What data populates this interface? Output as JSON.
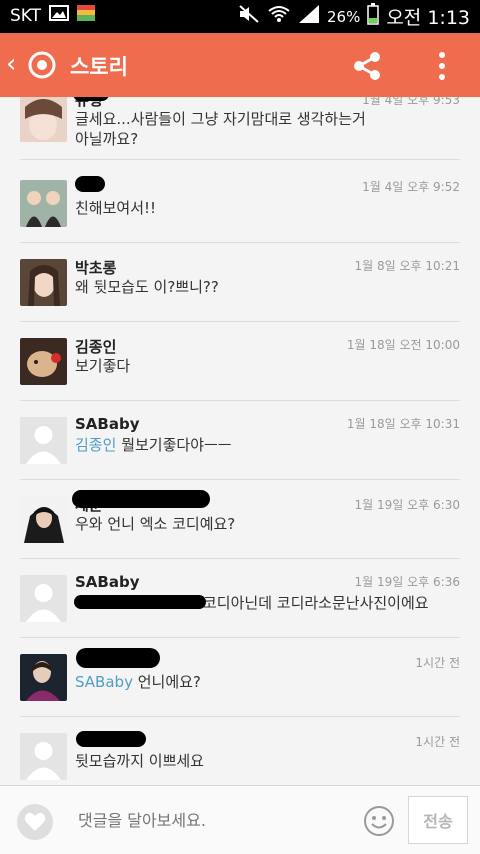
{
  "statusbar": {
    "carrier": "SKT",
    "battery_pct": "26%",
    "time": "오전 1:13"
  },
  "appbar": {
    "title": "스토리"
  },
  "comments": [
    {
      "name": "유형",
      "time": "1월 4일 오후 9:53",
      "lines": [
        "글세요...사람들이 그냥 자기맘대로 생각하는거",
        "아닐까요?"
      ]
    },
    {
      "name": "",
      "time": "1월 4일 오후 9:52",
      "lines": [
        "친해보여서!!"
      ]
    },
    {
      "name": "박초롱",
      "time": "1월 8일 오후 10:21",
      "lines": [
        "왜 뒷모습도 이?쁘니??"
      ]
    },
    {
      "name": "김종인",
      "time": "1월 18일 오전 10:00",
      "lines": [
        "보기좋다"
      ]
    },
    {
      "name": "SABaby",
      "time": "1월 18일 오후 10:31",
      "mention": "김종인",
      "text": "뭘보기좋다야ㅡㅡ"
    },
    {
      "name": "세훈",
      "time": "1월 19일 오후 6:30",
      "lines": [
        "우와 언니 엑소 코디예요?"
      ]
    },
    {
      "name": "SABaby",
      "time": "1월 19일 오후 6:36",
      "text": "코디아닌데 코디라소문난사진이에요"
    },
    {
      "name": "",
      "time": "1시간 전",
      "mention": "SABaby",
      "text": "언니에요?"
    },
    {
      "name": "",
      "time": "1시간 전",
      "lines": [
        "뒷모습까지 이쁘세요"
      ]
    }
  ],
  "composer": {
    "placeholder": "댓글을 달아보세요.",
    "send_label": "전송"
  },
  "colors": {
    "accent": "#f06c4e",
    "mention": "#4f9dc6"
  }
}
